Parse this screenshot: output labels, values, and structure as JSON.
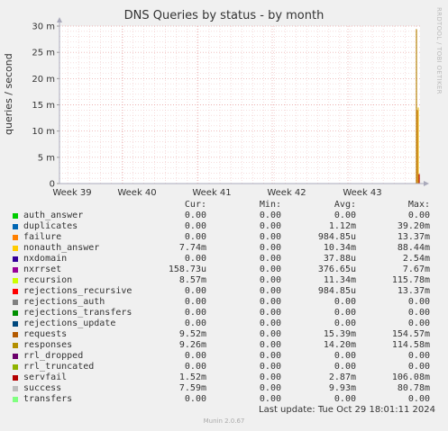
{
  "chart_data": {
    "type": "line",
    "title": "DNS Queries by status - by month",
    "ylabel": "queries / second",
    "side_label": "RRDTOOL / TOBI OETIKER",
    "y_ticks": [
      "0",
      "5 m",
      "10 m",
      "15 m",
      "20 m",
      "25 m",
      "30 m"
    ],
    "y_tick_values": [
      0,
      0.005,
      0.01,
      0.015,
      0.02,
      0.025,
      0.03
    ],
    "ylim": [
      0,
      0.03
    ],
    "x_ticks": [
      "Week 39",
      "Week 40",
      "Week 41",
      "Week 42",
      "Week 43"
    ],
    "grid": true,
    "spikes": [
      {
        "series": "responses",
        "value": 0.0294,
        "color": "#b8860b"
      },
      {
        "series": "nonauth_answer",
        "value": 0.0145,
        "color": "#e8c020"
      },
      {
        "series": "requests",
        "value": 0.014,
        "color": "#d08020"
      },
      {
        "series": "servfail",
        "value": 0.0018,
        "color": "#aa0000"
      }
    ]
  },
  "legend": {
    "headers": [
      "Cur:",
      "Min:",
      "Avg:",
      "Max:"
    ],
    "rows": [
      {
        "name": "auth_answer",
        "color": "#00cc00",
        "cur": "0.00",
        "min": "0.00",
        "avg": "0.00",
        "max": "0.00"
      },
      {
        "name": "duplicates",
        "color": "#0066b3",
        "cur": "0.00",
        "min": "0.00",
        "avg": "1.12m",
        "max": "39.20m"
      },
      {
        "name": "failure",
        "color": "#ff8000",
        "cur": "0.00",
        "min": "0.00",
        "avg": "984.85u",
        "max": "13.37m"
      },
      {
        "name": "nonauth_answer",
        "color": "#ffcc00",
        "cur": "7.74m",
        "min": "0.00",
        "avg": "10.34m",
        "max": "88.44m"
      },
      {
        "name": "nxdomain",
        "color": "#330099",
        "cur": "0.00",
        "min": "0.00",
        "avg": "37.88u",
        "max": "2.54m"
      },
      {
        "name": "nxrrset",
        "color": "#990099",
        "cur": "158.73u",
        "min": "0.00",
        "avg": "376.65u",
        "max": "7.67m"
      },
      {
        "name": "recursion",
        "color": "#ccff00",
        "cur": "8.57m",
        "min": "0.00",
        "avg": "11.34m",
        "max": "115.78m"
      },
      {
        "name": "rejections_recursive",
        "color": "#ff0000",
        "cur": "0.00",
        "min": "0.00",
        "avg": "984.85u",
        "max": "13.37m"
      },
      {
        "name": "rejections_auth",
        "color": "#808080",
        "cur": "0.00",
        "min": "0.00",
        "avg": "0.00",
        "max": "0.00"
      },
      {
        "name": "rejections_transfers",
        "color": "#008f00",
        "cur": "0.00",
        "min": "0.00",
        "avg": "0.00",
        "max": "0.00"
      },
      {
        "name": "rejections_update",
        "color": "#00487d",
        "cur": "0.00",
        "min": "0.00",
        "avg": "0.00",
        "max": "0.00"
      },
      {
        "name": "requests",
        "color": "#b35a00",
        "cur": "9.52m",
        "min": "0.00",
        "avg": "15.39m",
        "max": "154.57m"
      },
      {
        "name": "responses",
        "color": "#b38f00",
        "cur": "9.26m",
        "min": "0.00",
        "avg": "14.20m",
        "max": "114.58m"
      },
      {
        "name": "rrl_dropped",
        "color": "#6b006b",
        "cur": "0.00",
        "min": "0.00",
        "avg": "0.00",
        "max": "0.00"
      },
      {
        "name": "rrl_truncated",
        "color": "#8fb300",
        "cur": "0.00",
        "min": "0.00",
        "avg": "0.00",
        "max": "0.00"
      },
      {
        "name": "servfail",
        "color": "#b30000",
        "cur": "1.52m",
        "min": "0.00",
        "avg": "2.87m",
        "max": "106.08m"
      },
      {
        "name": "success",
        "color": "#bebebe",
        "cur": "7.59m",
        "min": "0.00",
        "avg": "9.93m",
        "max": "80.78m"
      },
      {
        "name": "transfers",
        "color": "#80ff80",
        "cur": "0.00",
        "min": "0.00",
        "avg": "0.00",
        "max": "0.00"
      }
    ]
  },
  "footer": {
    "last_update": "Last update: Tue Oct 29 18:01:11 2024",
    "munin": "Munin 2.0.67"
  }
}
